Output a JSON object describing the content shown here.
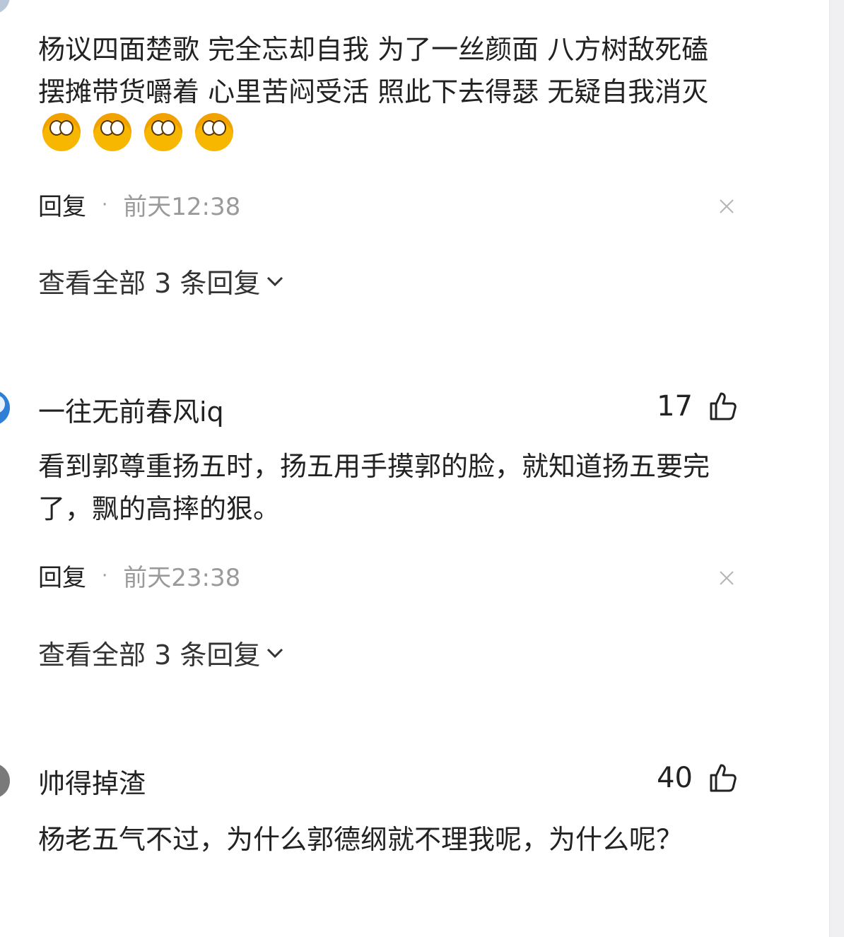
{
  "comments": [
    {
      "username": "一往无前春风iq",
      "likes": "17",
      "text": "看到郭尊重扬五时，扬五用手摸郭的脸，就知道扬五要完了，飘的高摔的狠。",
      "reply_label": "回复",
      "time": "前天23:38",
      "view_all": "查看全部 3 条回复"
    },
    {
      "username": "帅得掉渣",
      "likes": "40",
      "text": "杨老五气不过，为什么郭德纲就不理我呢，为什么呢？"
    }
  ],
  "first_comment": {
    "text": "杨议四面楚歌 完全忘却自我 为了一丝颜面 八方树敌死磕 摆摊带货嚼着 心里苦闷受活 照此下去得瑟 无疑自我消灭",
    "emoji_name": "peeking-face-emoji",
    "emoji_count": 4,
    "reply_label": "回复",
    "time": "前天12:38",
    "view_all": "查看全部 3 条回复"
  },
  "icons": {
    "like": "thumbs-up-icon",
    "close": "close-icon",
    "expand": "chevron-down-icon"
  }
}
